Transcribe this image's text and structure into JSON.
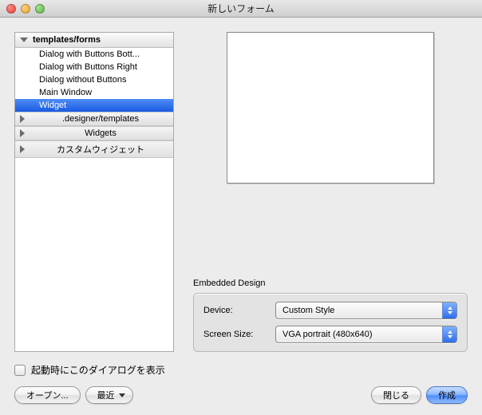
{
  "window": {
    "title": "新しいフォーム"
  },
  "tree": {
    "header": "templates/forms",
    "items": [
      {
        "label": "Dialog with Buttons Bott..."
      },
      {
        "label": "Dialog with Buttons Right"
      },
      {
        "label": "Dialog without Buttons"
      },
      {
        "label": "Main Window"
      },
      {
        "label": "Widget",
        "selected": true
      }
    ],
    "subheaders": [
      {
        "label": ".designer/templates"
      },
      {
        "label": "Widgets"
      },
      {
        "label": "カスタムウィジェット"
      }
    ]
  },
  "embedded": {
    "group_label": "Embedded Design",
    "device_label": "Device:",
    "device_value": "Custom Style",
    "screen_label": "Screen Size:",
    "screen_value": "VGA portrait (480x640)"
  },
  "checkbox": {
    "label": "起動時にこのダイアログを表示"
  },
  "buttons": {
    "open": "オープン...",
    "recent": "最近",
    "close": "閉じる",
    "create": "作成"
  }
}
